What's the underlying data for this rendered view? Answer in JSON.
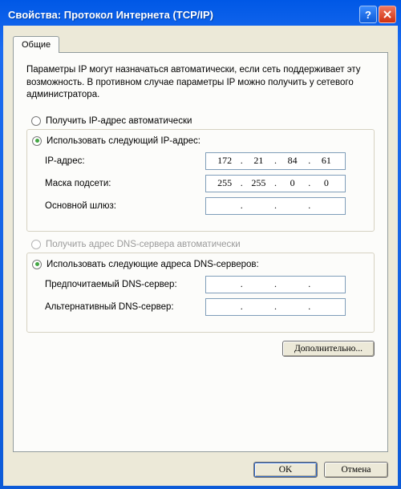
{
  "window": {
    "title": "Свойства: Протокол Интернета (TCP/IP)"
  },
  "tab": {
    "label": "Общие"
  },
  "description": "Параметры IP могут назначаться автоматически, если сеть поддерживает эту возможность. В противном случае параметры IP можно получить у сетевого администратора.",
  "ip": {
    "radio_auto": "Получить IP-адрес автоматически",
    "radio_manual": "Использовать следующий IP-адрес:",
    "addr_label": "IP-адрес:",
    "addr": {
      "o1": "172",
      "o2": "21",
      "o3": "84",
      "o4": "61"
    },
    "mask_label": "Маска подсети:",
    "mask": {
      "o1": "255",
      "o2": "255",
      "o3": "0",
      "o4": "0"
    },
    "gw_label": "Основной шлюз:",
    "gw": {
      "o1": "",
      "o2": "",
      "o3": "",
      "o4": ""
    }
  },
  "dns": {
    "radio_auto": "Получить адрес DNS-сервера автоматически",
    "radio_manual": "Использовать следующие адреса DNS-серверов:",
    "pref_label": "Предпочитаемый DNS-сервер:",
    "pref": {
      "o1": "",
      "o2": "",
      "o3": "",
      "o4": ""
    },
    "alt_label": "Альтернативный DNS-сервер:",
    "alt": {
      "o1": "",
      "o2": "",
      "o3": "",
      "o4": ""
    }
  },
  "buttons": {
    "advanced": "Дополнительно...",
    "ok": "OK",
    "cancel": "Отмена"
  }
}
